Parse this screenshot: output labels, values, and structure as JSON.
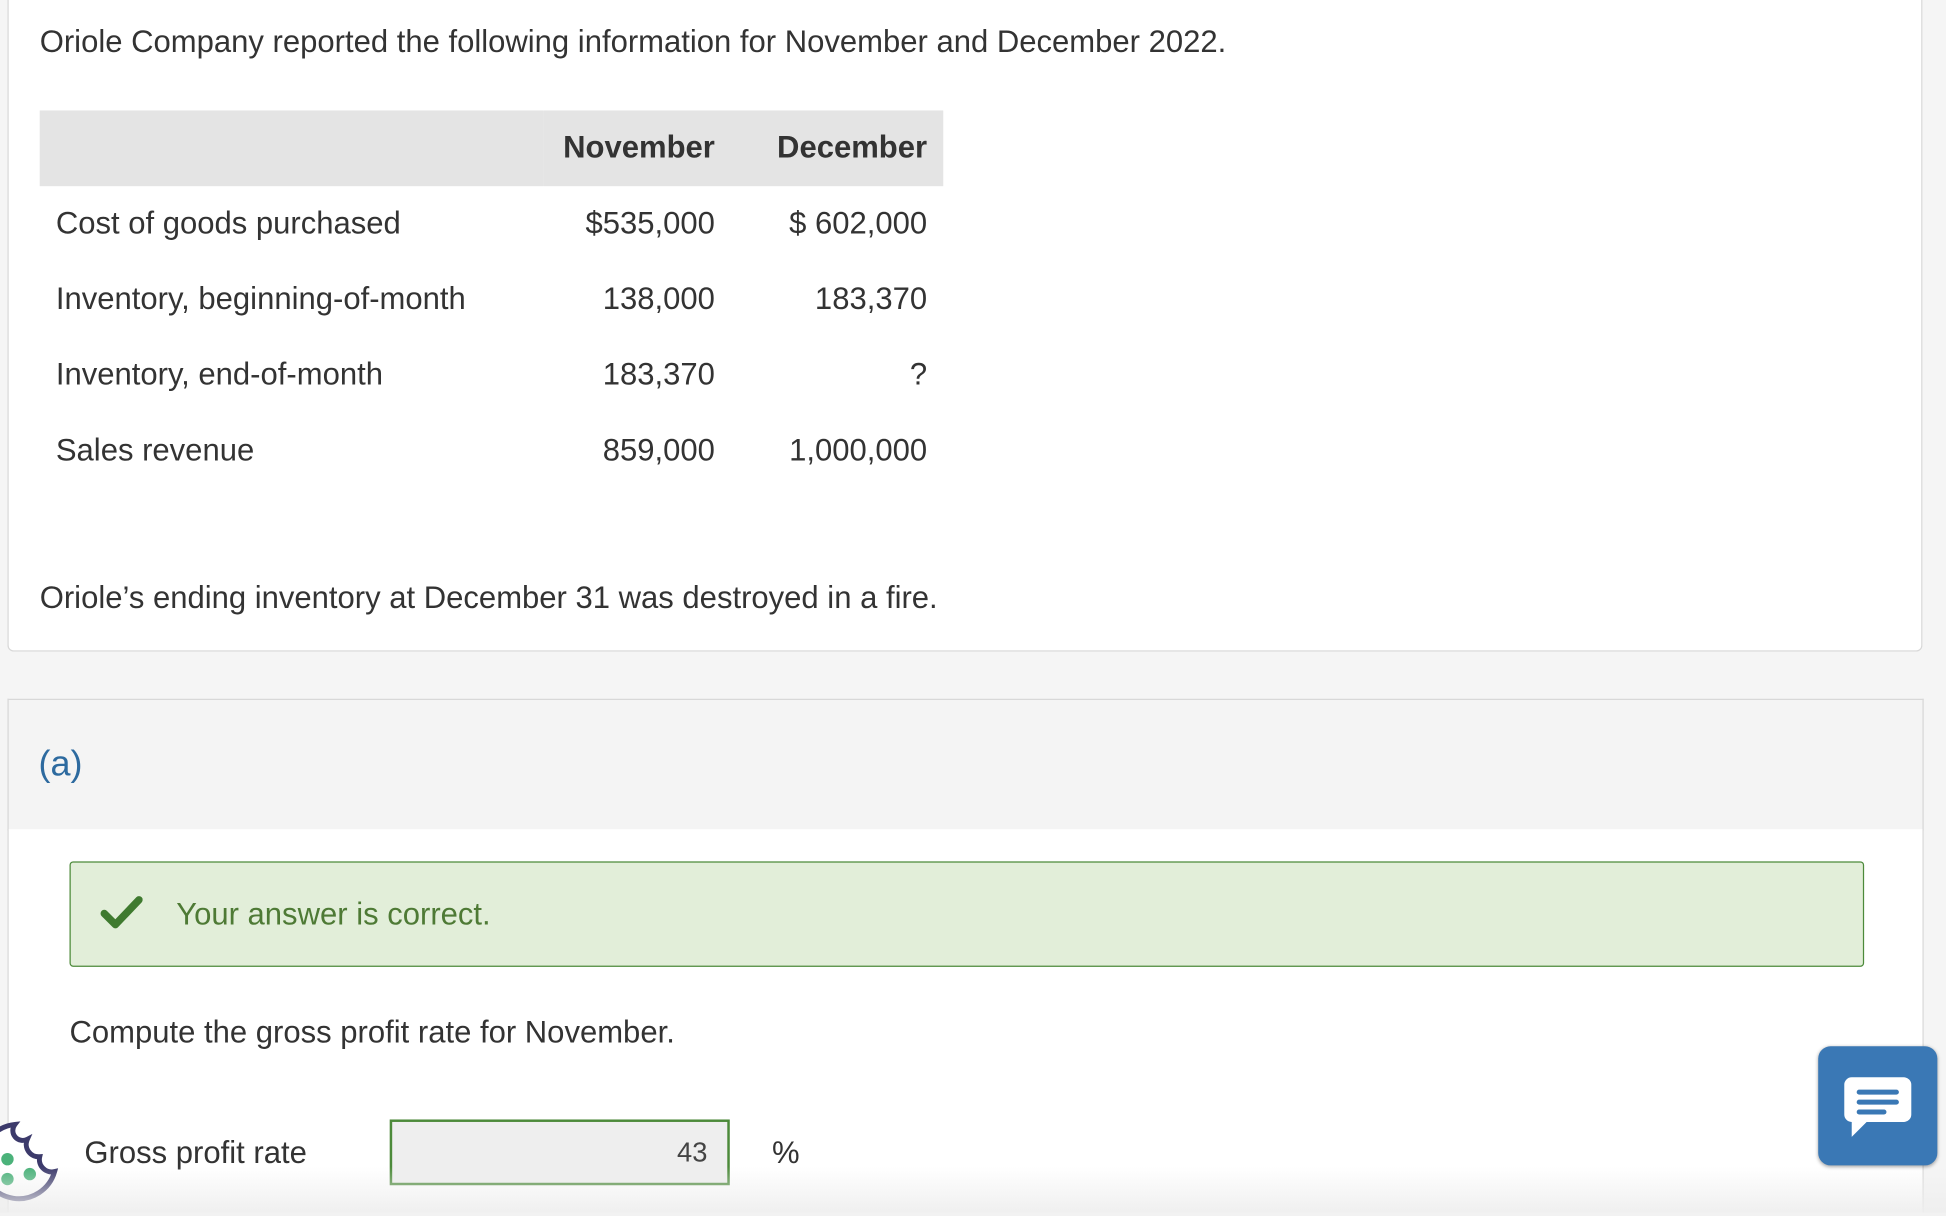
{
  "intro": "Oriole Company reported the following information for November and December 2022.",
  "table": {
    "headers": [
      "",
      "November",
      "December"
    ],
    "rows": [
      {
        "label": "Cost of goods purchased",
        "nov": "$535,000",
        "dec": "$ 602,000"
      },
      {
        "label": "Inventory, beginning-of-month",
        "nov": "138,000",
        "dec": "183,370"
      },
      {
        "label": "Inventory, end-of-month",
        "nov": "183,370",
        "dec": "?"
      },
      {
        "label": "Sales revenue",
        "nov": "859,000",
        "dec": "1,000,000"
      }
    ]
  },
  "fire_note": "Oriole’s ending inventory at December 31 was destroyed in a fire.",
  "part": {
    "label": "(a)",
    "feedback": "Your answer is correct.",
    "question": "Compute the gross profit rate for November.",
    "field_label": "Gross profit rate",
    "field_value": "43",
    "unit": "%"
  },
  "icons": {
    "check": "check-icon",
    "chat": "chat-icon",
    "cookie": "cookie-icon"
  },
  "colors": {
    "accent_blue": "#2d6a9f",
    "success_green": "#4c8a3a",
    "success_bg": "#e2eed9",
    "chat_bg": "#3a78b5"
  }
}
